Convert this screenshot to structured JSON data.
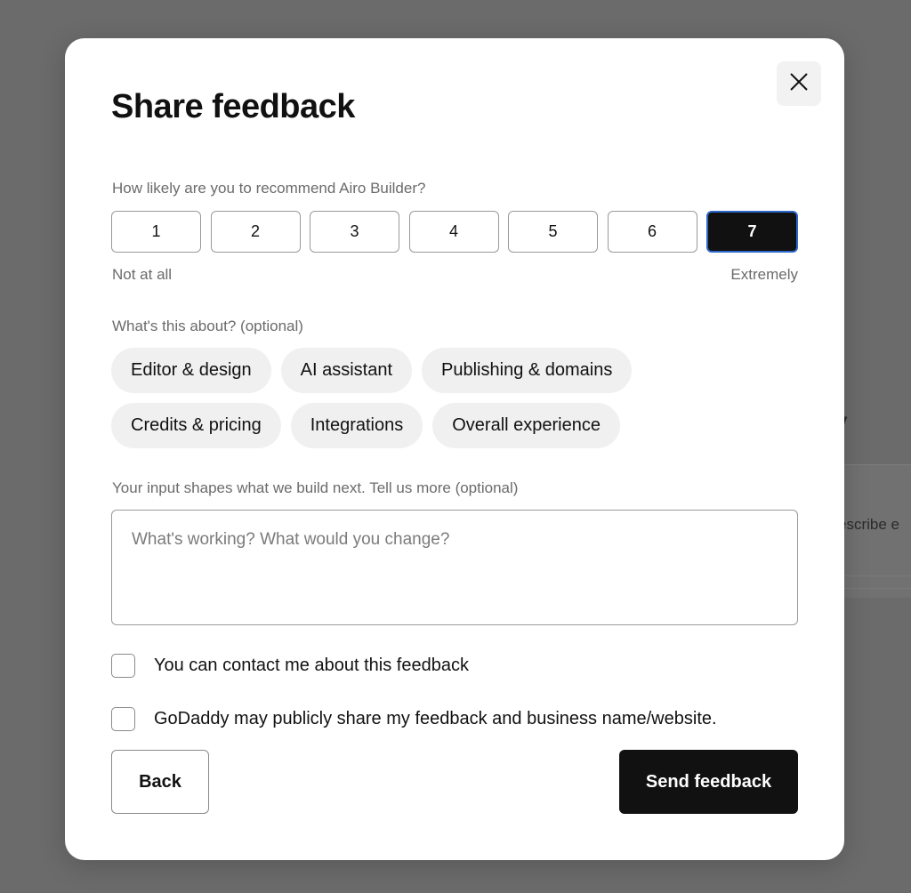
{
  "background": {
    "partial_text": "escribe e",
    "partial_glyph": "v"
  },
  "dialog": {
    "title": "Share feedback",
    "close_icon": "close-icon",
    "rating": {
      "question": "How likely are you to recommend Airo Builder?",
      "options": [
        "1",
        "2",
        "3",
        "4",
        "5",
        "6",
        "7"
      ],
      "selected": "7",
      "min_label": "Not at all",
      "max_label": "Extremely"
    },
    "topics": {
      "question": "What's this about? (optional)",
      "options": [
        "Editor & design",
        "AI assistant",
        "Publishing & domains",
        "Credits & pricing",
        "Integrations",
        "Overall experience"
      ]
    },
    "comments": {
      "label": "Your input shapes what we build next. Tell us more (optional)",
      "placeholder": "What's working? What would you change?",
      "value": ""
    },
    "checkboxes": [
      {
        "label": "You can contact me about this feedback",
        "checked": false
      },
      {
        "label": "GoDaddy may publicly share my feedback and business name/website.",
        "checked": false
      }
    ],
    "buttons": {
      "back": "Back",
      "send": "Send feedback"
    }
  },
  "colors": {
    "overlay": "#6a6b6a",
    "selected_fill": "#111111",
    "selected_border": "#2d67c9",
    "chip_bg": "#f0f0f0",
    "primary_button": "#111111"
  }
}
